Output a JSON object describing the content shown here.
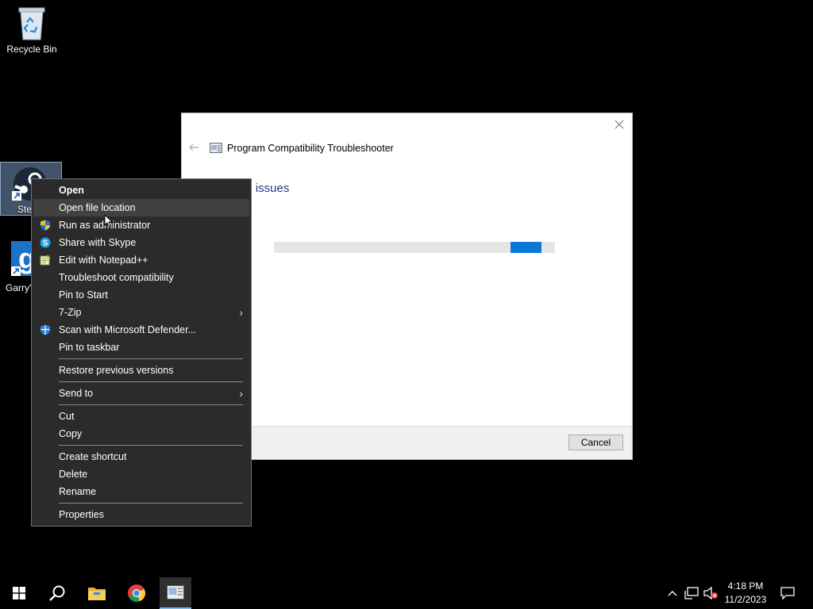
{
  "desktop": {
    "icons": [
      {
        "label": "Recycle Bin"
      },
      {
        "label": "Ste"
      },
      {
        "label": "Garry's"
      }
    ]
  },
  "troubleshooter": {
    "title": "Program Compatibility Troubleshooter",
    "heading": "ng issues",
    "progress": 0.11,
    "cancel_label": "Cancel"
  },
  "context_menu": {
    "items": [
      {
        "label": "Open",
        "icon": ""
      },
      {
        "label": "Open file location",
        "icon": ""
      },
      {
        "label": "Run as administrator",
        "icon": "uac-shield-icon"
      },
      {
        "label": "Share with Skype",
        "icon": "skype-icon"
      },
      {
        "label": "Edit with Notepad++",
        "icon": "notepad-plus-plus-icon"
      },
      {
        "label": "Troubleshoot compatibility",
        "icon": ""
      },
      {
        "label": "Pin to Start",
        "icon": ""
      },
      {
        "label": "7-Zip",
        "icon": "",
        "submenu": true
      },
      {
        "label": "Scan with Microsoft Defender...",
        "icon": "defender-icon"
      },
      {
        "label": "Pin to taskbar",
        "icon": ""
      },
      {
        "label": "Restore previous versions",
        "icon": ""
      },
      {
        "label": "Send to",
        "icon": "",
        "submenu": true
      },
      {
        "label": "Cut",
        "icon": ""
      },
      {
        "label": "Copy",
        "icon": ""
      },
      {
        "label": "Create shortcut",
        "icon": ""
      },
      {
        "label": "Delete",
        "icon": ""
      },
      {
        "label": "Rename",
        "icon": ""
      },
      {
        "label": "Properties",
        "icon": ""
      }
    ]
  },
  "taskbar": {
    "apps": [
      "start-icon",
      "search-icon",
      "file-explorer-icon",
      "chrome-icon",
      "troubleshooter-icon"
    ],
    "clock_time": "4:18 PM",
    "clock_date": "11/2/2023"
  },
  "colors": {
    "accent": "#0a78d7",
    "menu_bg": "#2b2b2b",
    "heading_blue": "#1e3f8a"
  }
}
